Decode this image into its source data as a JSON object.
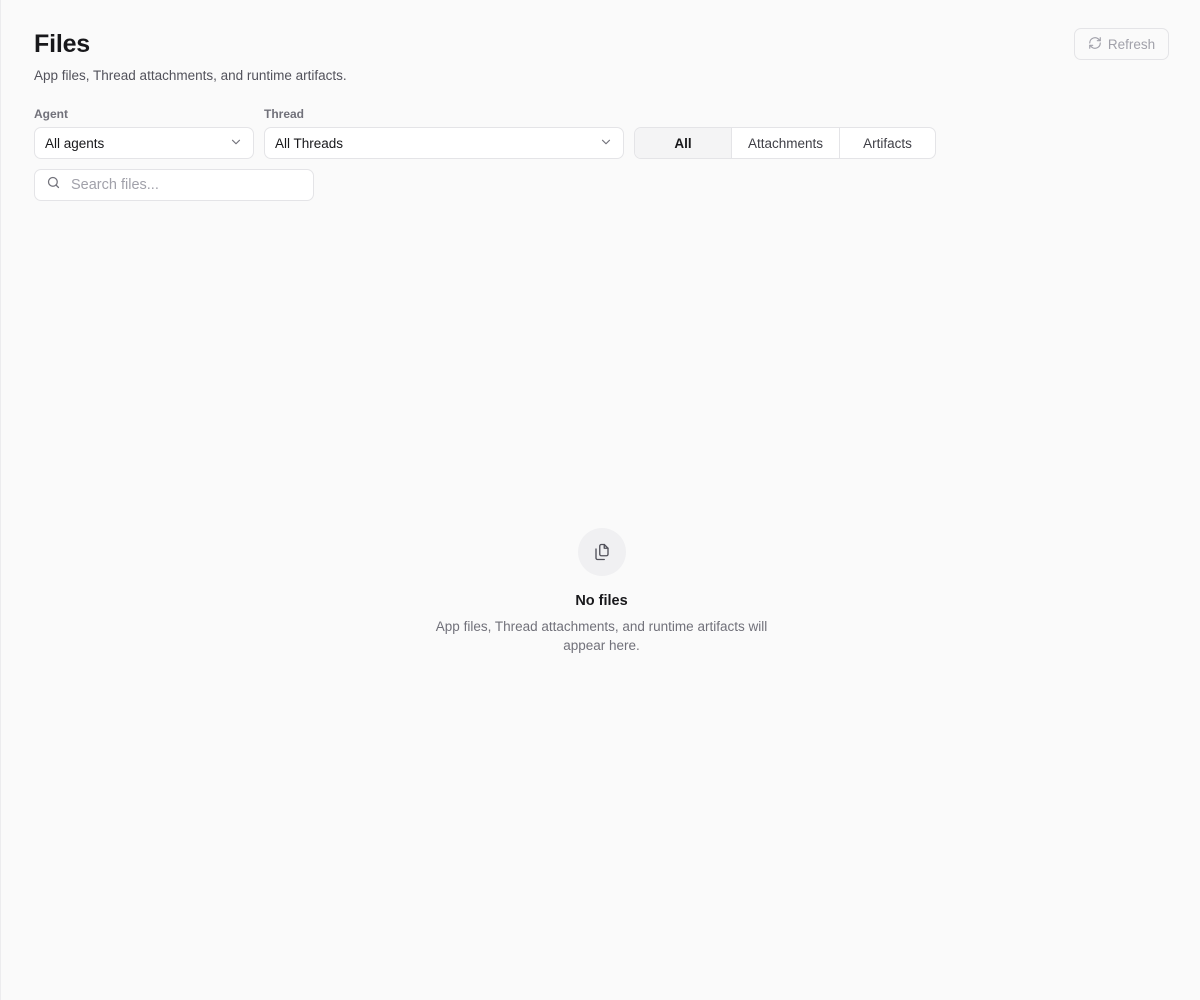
{
  "header": {
    "title": "Files",
    "subtitle": "App files, Thread attachments, and runtime artifacts.",
    "refresh_label": "Refresh"
  },
  "filters": {
    "agent": {
      "label": "Agent",
      "value": "All agents"
    },
    "thread": {
      "label": "Thread",
      "value": "All Threads"
    },
    "tabs": [
      {
        "label": "All",
        "active": true
      },
      {
        "label": "Attachments",
        "active": false
      },
      {
        "label": "Artifacts",
        "active": false
      }
    ]
  },
  "search": {
    "placeholder": "Search files...",
    "value": ""
  },
  "empty_state": {
    "icon": "files-icon",
    "title": "No files",
    "description": "App files, Thread attachments, and runtime artifacts will appear here."
  },
  "icons": {
    "refresh": "refresh-icon",
    "chevron": "chevron-down-icon",
    "search": "search-icon"
  },
  "colors": {
    "background": "#fafafa",
    "border": "#e4e4e7",
    "text": "#18181b",
    "muted": "#71717a",
    "active_tab": "#f4f4f5"
  }
}
